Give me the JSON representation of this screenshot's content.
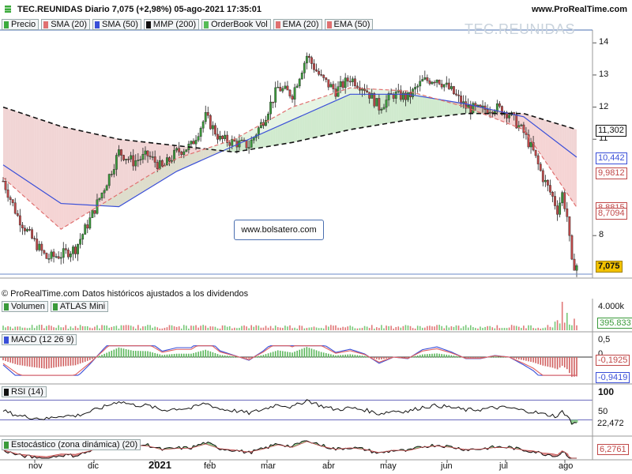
{
  "header": {
    "title": "TEC.REUNIDAS Diario 7,075 (+2,98%) 05-ago-2021 17:35:01",
    "site": "www.ProRealTime.com"
  },
  "legend": [
    {
      "label": "Precio",
      "color": "#3caa3c"
    },
    {
      "label": "SMA (20)",
      "color": "#e07070"
    },
    {
      "label": "SMA (50)",
      "color": "#3a4fd8"
    },
    {
      "label": "MMP (200)",
      "color": "#111111"
    },
    {
      "label": "OrderBook Vol",
      "color": "#55bb55"
    },
    {
      "label": "EMA (20)",
      "color": "#e07070"
    },
    {
      "label": "EMA (50)",
      "color": "#e07070"
    }
  ],
  "watermark": "TEC.REUNIDAS",
  "site_box": "www.bolsatero.com",
  "note": "© ProRealTime.com Datos históricos ajustados a los dividendos",
  "colors": {
    "up": "#3a9a3a",
    "down": "#c04848",
    "sma50": "#3a4fd8",
    "mmp200": "#111111",
    "sma20": "#e07070"
  },
  "chart_data": [
    {
      "type": "candlestick",
      "name": "Precio",
      "y_ticks": [
        "14",
        "13",
        "12",
        "11",
        "8"
      ],
      "ylim": [
        6.8,
        14.4
      ],
      "last_price": "7,075",
      "price_tags": [
        {
          "label": "11,302",
          "value": 11.302,
          "color": "#111111"
        },
        {
          "label": "10,442",
          "value": 10.442,
          "color": "#3a4fd8"
        },
        {
          "label": "9,9812",
          "value": 9.9812,
          "color": "#c04848"
        },
        {
          "label": "8,8815",
          "value": 8.8815,
          "color": "#c04848"
        },
        {
          "label": "8,7094",
          "value": 8.7094,
          "color": "#c04848"
        },
        {
          "label": "7,075",
          "value": 7.075,
          "color": "#c8a000"
        }
      ],
      "x_labels": [
        "nov",
        "dic",
        "2021",
        "feb",
        "mar",
        "abr",
        "may",
        "jun",
        "jul",
        "ago"
      ],
      "series": [
        {
          "name": "Precio",
          "x": [
            0,
            6,
            12,
            18,
            24,
            30,
            36,
            42,
            48,
            54,
            60,
            66,
            72,
            78,
            84,
            90,
            96,
            102,
            108,
            114,
            120,
            126,
            132,
            138,
            144,
            150,
            156,
            162,
            168,
            174,
            180,
            186,
            192,
            198,
            204,
            210,
            216,
            220,
            224,
            228,
            230,
            232,
            234,
            236,
            238
          ],
          "values": [
            9.7,
            8.6,
            7.9,
            7.3,
            7.4,
            7.6,
            8.5,
            9.5,
            10.6,
            10.3,
            10.5,
            10.1,
            10.6,
            10.8,
            11.7,
            11.0,
            10.9,
            10.8,
            11.6,
            12.6,
            12.4,
            13.6,
            12.9,
            12.5,
            12.9,
            12.6,
            12.0,
            12.4,
            12.3,
            12.8,
            12.9,
            12.5,
            12.0,
            11.9,
            12.0,
            11.8,
            11.2,
            10.6,
            9.8,
            9.2,
            8.8,
            9.3,
            8.6,
            7.1,
            7.075
          ]
        },
        {
          "name": "SMA (50)",
          "x": [
            0,
            24,
            48,
            72,
            96,
            120,
            144,
            168,
            192,
            216,
            238
          ],
          "values": [
            10.2,
            9.0,
            8.9,
            10.0,
            10.8,
            11.6,
            12.4,
            12.4,
            12.1,
            11.7,
            10.44
          ]
        },
        {
          "name": "MMP (200)",
          "x": [
            0,
            24,
            48,
            72,
            96,
            120,
            144,
            168,
            192,
            216,
            238
          ],
          "values": [
            12.0,
            11.4,
            11.0,
            10.8,
            10.6,
            10.9,
            11.3,
            11.6,
            11.8,
            11.8,
            11.3
          ]
        },
        {
          "name": "SMA (20)",
          "x": [
            0,
            24,
            48,
            72,
            96,
            120,
            144,
            168,
            192,
            216,
            238
          ],
          "values": [
            9.8,
            8.2,
            9.3,
            10.4,
            11.0,
            12.0,
            12.6,
            12.5,
            12.0,
            11.3,
            8.88
          ]
        }
      ]
    },
    {
      "type": "bar",
      "name": "Volumen",
      "legend": [
        "Volumen",
        "ATLAS Mini"
      ],
      "y_ticks": [
        "4.000k"
      ],
      "last_value": "395.833",
      "ylim": [
        0,
        4200
      ]
    },
    {
      "type": "line",
      "name": "MACD (12 26 9)",
      "legend": [
        "MACD (12 26 9)"
      ],
      "y_ticks": [
        "0,5",
        "0"
      ],
      "value_tags": [
        {
          "label": "-0,1925",
          "color": "#c04848"
        },
        {
          "label": "-0,9419",
          "color": "#3a4fd8"
        }
      ],
      "ylim": [
        -1.1,
        0.7
      ]
    },
    {
      "type": "line",
      "name": "RSI (14)",
      "legend": [
        "RSI (14)"
      ],
      "y_ticks": [
        "100",
        "50"
      ],
      "last_value": "22,472",
      "ylim": [
        0,
        100
      ]
    },
    {
      "type": "line",
      "name": "Estocástico (zona dinámica) (20)",
      "legend": [
        "Estocástico (zona dinámica) (20)"
      ],
      "last_value": "6,2761",
      "ylim": [
        0,
        100
      ]
    }
  ]
}
